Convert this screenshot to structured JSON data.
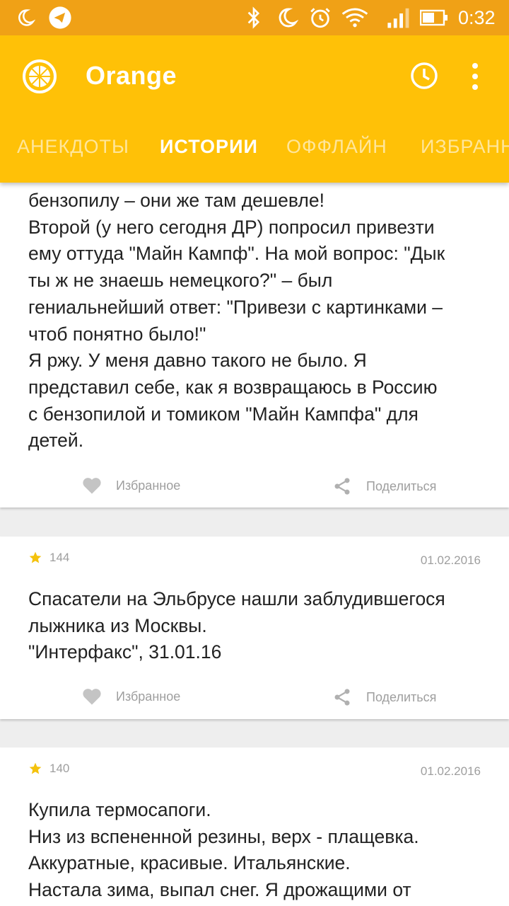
{
  "status_bar": {
    "time": "0:32"
  },
  "app_bar": {
    "title": "Orange",
    "tabs": [
      {
        "label": "АНЕКДОТЫ",
        "active": false
      },
      {
        "label": "ИСТОРИИ",
        "active": true
      },
      {
        "label": "ОФФЛАЙН",
        "active": false
      },
      {
        "label": "ИЗБРАНН",
        "active": false
      }
    ]
  },
  "colors": {
    "status_bar": "#f0a116",
    "app_bar": "#ffc107",
    "tab_indicator": "#5a8fd6",
    "star": "#f4c20d",
    "muted_text": "#9e9e9e"
  },
  "stories": [
    {
      "text_lines": [
        "бензопилу – они же там дешевле!",
        "Второй (у него сегодня ДР) попросил привезти",
        "ему оттуда \"Майн Кампф\". На мой вопрос: \"Дык",
        "ты ж не знаешь немецкого?\" – был",
        "гениальнейший ответ: \"Привези с картинками –",
        "чтоб понятно было!\"",
        "Я ржу. У меня давно такого не было. Я",
        "представил себе, как я возвращаюсь в Россию",
        "с бензопилой и томиком \"Майн Кампфа\" для",
        "детей."
      ],
      "favorite_label": "Избранное",
      "share_label": "Поделиться"
    },
    {
      "rating": "144",
      "date": "01.02.2016",
      "text_lines": [
        "Спасатели на Эльбрусе нашли заблудившегося",
        "лыжника из Москвы.",
        "\"Интерфакс\", 31.01.16"
      ],
      "favorite_label": "Избранное",
      "share_label": "Поделиться"
    },
    {
      "rating": "140",
      "date": "01.02.2016",
      "text_lines": [
        "Купила термосапоги.",
        "Низ из вспененной резины, верх - плащевка.",
        "Аккуратные, красивые. Итальянские.",
        "Настала зима, выпал снег. Я дрожащими от"
      ]
    }
  ]
}
